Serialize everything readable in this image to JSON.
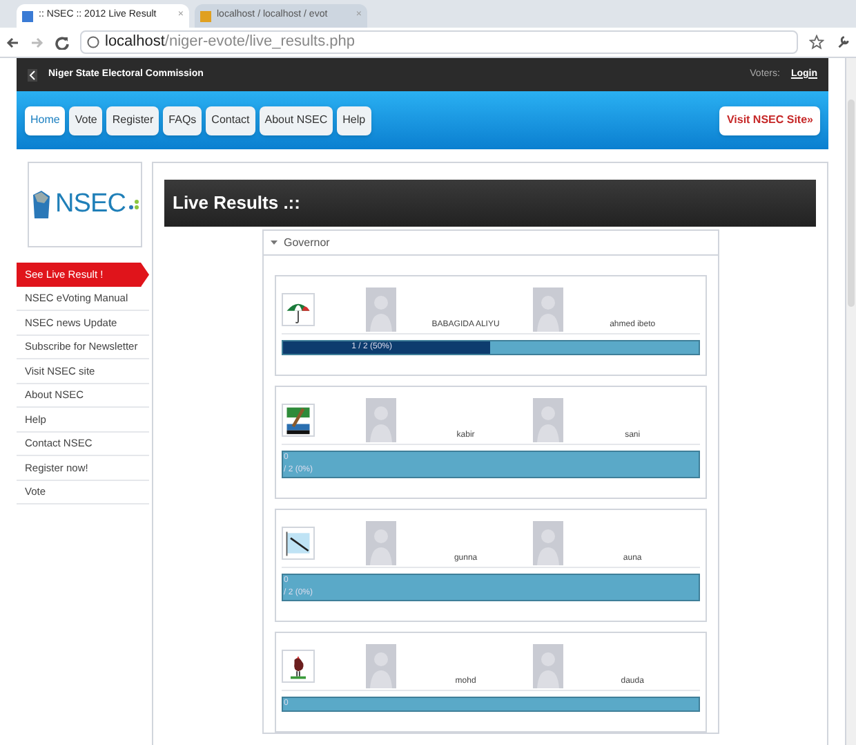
{
  "browser": {
    "tabs": [
      {
        "label": ":: NSEC :: 2012 Live Result",
        "close": "×",
        "selected": true
      },
      {
        "label": "localhost / localhost / evot",
        "close": "×",
        "selected": false
      }
    ],
    "address": {
      "host": "localhost",
      "path": "/niger-evote/live_results.php"
    }
  },
  "top_bar": {
    "title": "Niger State Electoral Commission",
    "voters_label": "Voters:",
    "login_link": "Login"
  },
  "nav": {
    "items": [
      {
        "label": "Home",
        "selected": true
      },
      {
        "label": "Vote",
        "selected": false
      },
      {
        "label": "Register",
        "selected": false
      },
      {
        "label": "FAQs",
        "selected": false
      },
      {
        "label": "Contact",
        "selected": false
      },
      {
        "label": "About NSEC",
        "selected": false
      },
      {
        "label": "Help",
        "selected": false
      }
    ],
    "visit_button": "Visit NSEC Site»"
  },
  "sidebar": {
    "logo_text": "NSEC",
    "items": [
      {
        "label": "See Live Result !",
        "selected": true
      },
      {
        "label": "NSEC eVoting Manual",
        "selected": false
      },
      {
        "label": "NSEC news Update",
        "selected": false
      },
      {
        "label": "Subscribe for Newsletter",
        "selected": false
      },
      {
        "label": "Visit NSEC site",
        "selected": false
      },
      {
        "label": "About NSEC",
        "selected": false
      },
      {
        "label": "Help",
        "selected": false
      },
      {
        "label": "Contact NSEC",
        "selected": false
      },
      {
        "label": "Register now!",
        "selected": false
      },
      {
        "label": "Vote",
        "selected": false
      }
    ]
  },
  "main": {
    "title": "Live Results .::",
    "section": {
      "title": "Governor",
      "expanded": true,
      "candidates": [
        {
          "kind": "umbrella",
          "names": [
            "BABAGIDA ALIYU",
            "ahmed ibeto"
          ],
          "level": 0.5,
          "reading_lines": [
            "1 / 2 (50%)"
          ]
        },
        {
          "kind": "broom",
          "names": [
            "kabir",
            "sani"
          ],
          "level": 0,
          "reading_lines": [
            "0",
            "/ 2 (0%)"
          ]
        },
        {
          "kind": "flag",
          "names": [
            "gunna",
            "auna"
          ],
          "level": 0,
          "reading_lines": [
            "0",
            "/ 2 (0%)"
          ]
        },
        {
          "kind": "rooster",
          "names": [
            "mohd",
            "dauda"
          ],
          "level": 0,
          "reading_lines": [
            "0"
          ]
        }
      ]
    }
  }
}
